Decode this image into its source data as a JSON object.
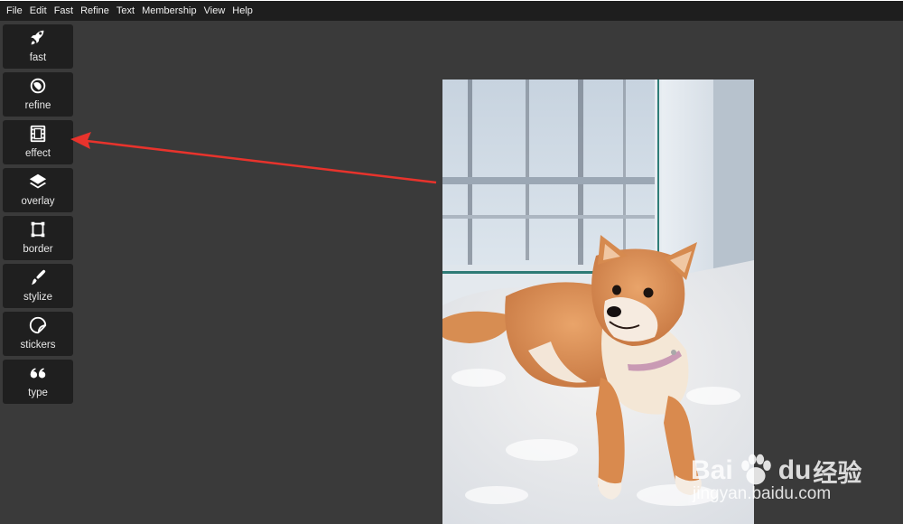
{
  "menubar": {
    "items": [
      "File",
      "Edit",
      "Fast",
      "Refine",
      "Text",
      "Membership",
      "View",
      "Help"
    ]
  },
  "sidebar": {
    "tools": [
      {
        "label": "fast",
        "icon": "rocket-icon"
      },
      {
        "label": "refine",
        "icon": "refine-icon"
      },
      {
        "label": "effect",
        "icon": "film-icon"
      },
      {
        "label": "overlay",
        "icon": "layers-icon"
      },
      {
        "label": "border",
        "icon": "border-frame-icon"
      },
      {
        "label": "stylize",
        "icon": "brush-icon"
      },
      {
        "label": "stickers",
        "icon": "sticker-icon"
      },
      {
        "label": "type",
        "icon": "quote-icon"
      }
    ]
  },
  "canvas": {
    "image_subject": "shiba-inu-dog-on-fluffy-rug-by-window"
  },
  "annotation": {
    "arrow_color": "#e8332c",
    "arrow_target": "effect"
  },
  "watermark": {
    "brand_left": "Bai",
    "brand_right": "du",
    "brand_cn": "经验",
    "url": "jingyan.baidu.com"
  },
  "colors": {
    "app_bg": "#3a3a3a",
    "menubar_bg": "#1e1e1e",
    "tool_bg": "#1f1f1f",
    "text": "#e8e8e8"
  }
}
